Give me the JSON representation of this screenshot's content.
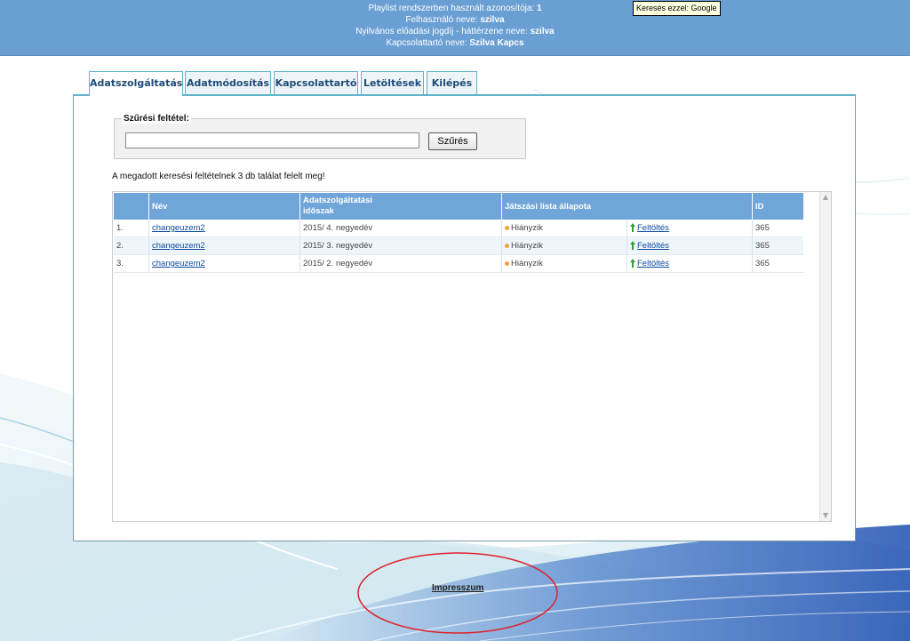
{
  "header": {
    "line1_label": "Playlist rendszerben használt azonosítója:",
    "line1_value": "1",
    "line2_label": "Felhasználó neve:",
    "line2_value": "szilva",
    "line3_label": "Nyilvános előadási jogdíj - háttérzene neve:",
    "line3_value": "szilva",
    "line4_label": "Kapcsolattartó neve:",
    "line4_value": "Szilva Kapcs"
  },
  "google_tooltip": "Keresés ezzel: Google",
  "tabs": [
    {
      "label": "Adatszolgáltatás",
      "active": true
    },
    {
      "label": "Adatmódosítás"
    },
    {
      "label": "Kapcsolattartó"
    },
    {
      "label": "Letöltések"
    },
    {
      "label": "Kilépés"
    }
  ],
  "filter": {
    "legend": "Szűrési feltétel:",
    "value": "",
    "button": "Szűrés"
  },
  "result_text": "A megadott keresési feltételnek 3 db találat felelt meg!",
  "grid": {
    "columns": {
      "num": "",
      "name": "Név",
      "period_1": "Adatszolgáltatási",
      "period_2": "időszak",
      "status": "Játszási lista állapota",
      "id": "ID"
    },
    "rows": [
      {
        "num": "1.",
        "name": "changeuzem2",
        "period": "2015/ 4. negyedév",
        "status": "Hiányzik",
        "action": "Feltöltés",
        "id": "365"
      },
      {
        "num": "2.",
        "name": "changeuzem2",
        "period": "2015/ 3. negyedév",
        "status": "Hiányzik",
        "action": "Feltöltés",
        "id": "365"
      },
      {
        "num": "3.",
        "name": "changeuzem2",
        "period": "2015/ 2. negyedév",
        "status": "Hiányzik",
        "action": "Feltöltés",
        "id": "365"
      }
    ]
  },
  "footer": {
    "link": "Impresszum"
  },
  "colors": {
    "header_bg": "#6a9fd4",
    "grid_header": "#6fa5d8",
    "tab_border": "#5fb2c8",
    "annotation_circle": "#e0202a"
  },
  "icons": {
    "status": "orange-dot-icon",
    "upload": "green-up-arrow-icon"
  }
}
